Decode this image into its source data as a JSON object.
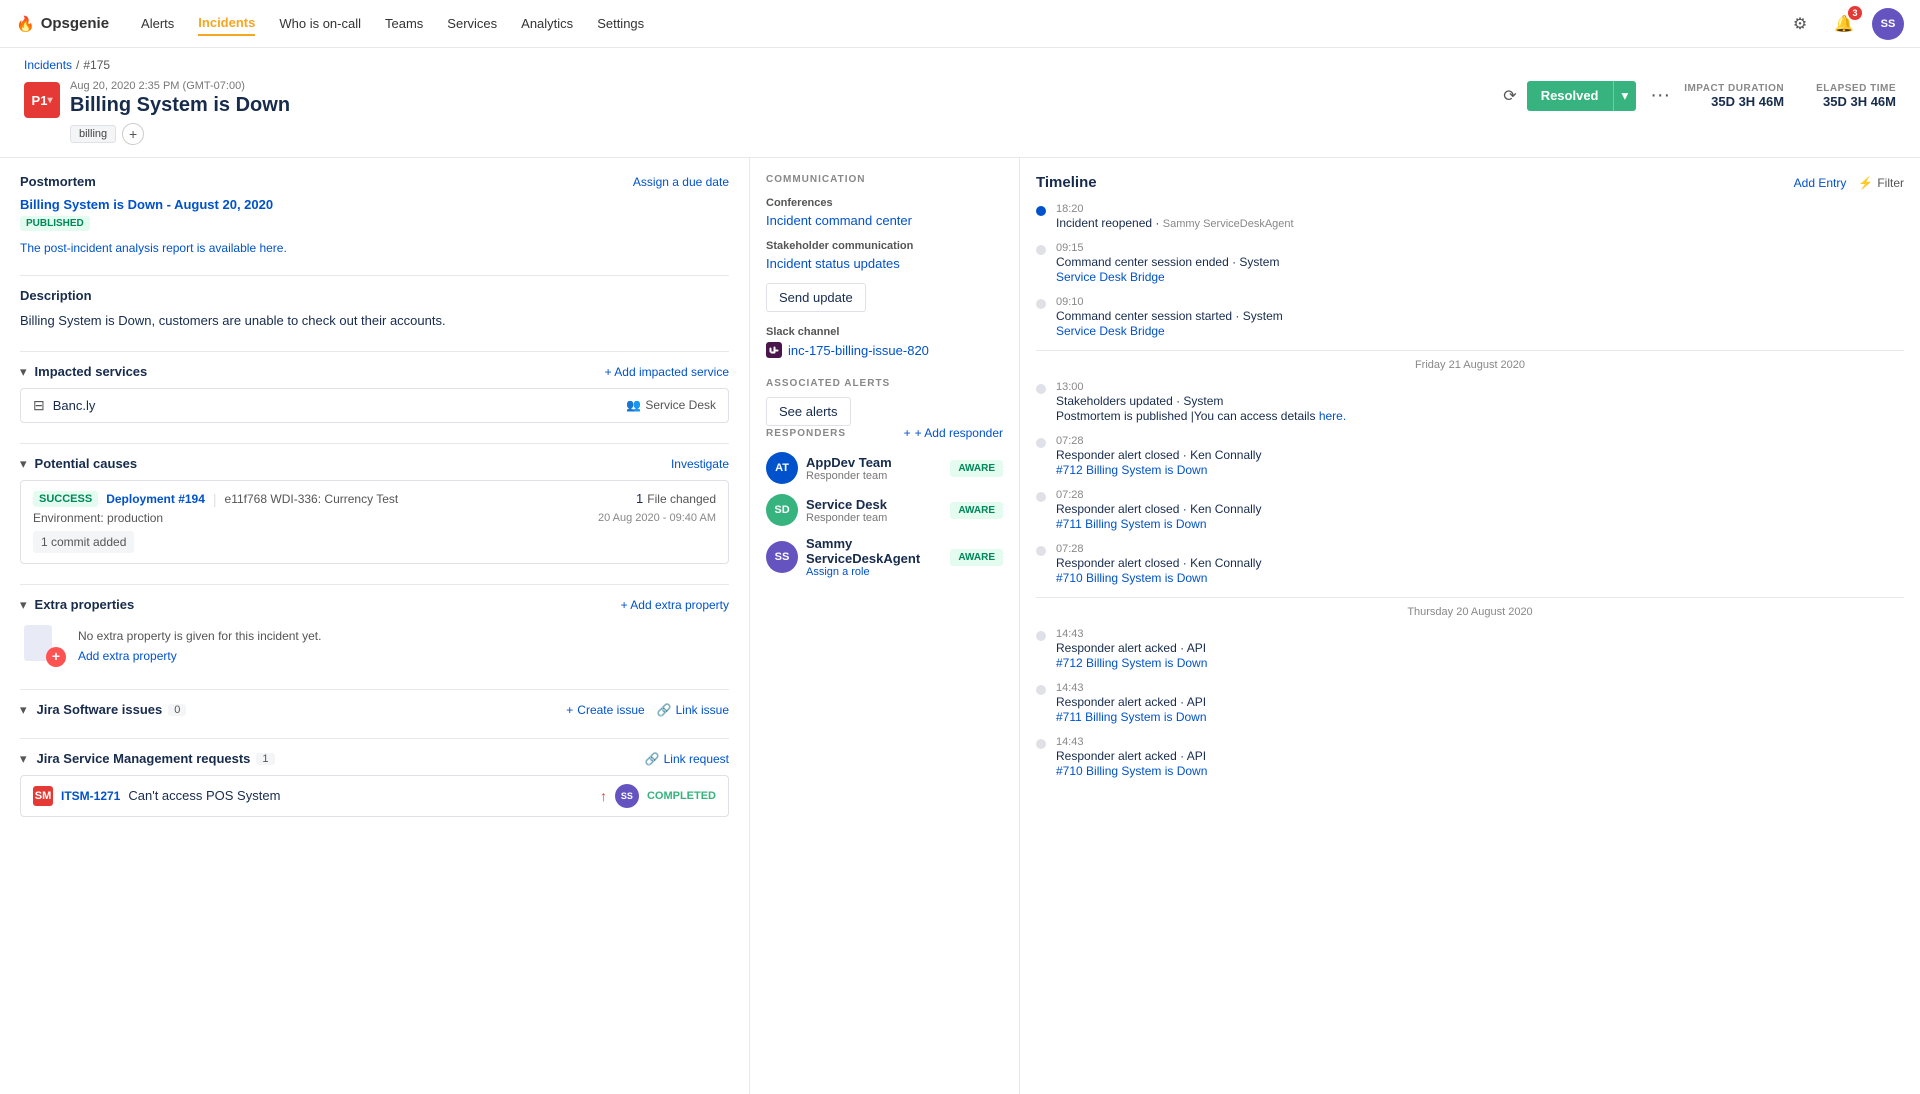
{
  "app": {
    "logo": "🔥",
    "name": "Opsgenie",
    "nav_items": [
      "Alerts",
      "Incidents",
      "Who is on-call",
      "Teams",
      "Services",
      "Analytics",
      "Settings"
    ],
    "active_nav": "Incidents",
    "notification_count": "3",
    "user_initials": "SS"
  },
  "breadcrumb": {
    "incidents_label": "Incidents",
    "separator": "/",
    "incident_id": "#175"
  },
  "incident": {
    "priority": "P1",
    "date": "Aug 20, 2020 2:35 PM (GMT-07:00)",
    "title": "Billing System is Down",
    "tags": [
      "billing"
    ],
    "add_tag_label": "+",
    "status": "Resolved",
    "impact_duration_label": "IMPACT DURATION",
    "impact_duration": "35D 3H 46M",
    "elapsed_time_label": "ELAPSED TIME",
    "elapsed_time": "35D 3H 46M"
  },
  "postmortem": {
    "section_title": "Postmortem",
    "due_date_label": "Assign a due date",
    "link_text": "Billing System is Down - August 20, 2020",
    "status": "PUBLISHED",
    "note": "The post-incident analysis report is available here."
  },
  "description": {
    "section_title": "Description",
    "text": "Billing System is Down, customers are unable to check out their accounts."
  },
  "impacted_services": {
    "section_title": "Impacted services",
    "add_label": "+ Add impacted service",
    "services": [
      {
        "name": "Banc.ly",
        "team": "Service Desk"
      }
    ]
  },
  "potential_causes": {
    "section_title": "Potential causes",
    "investigate_label": "Investigate",
    "causes": [
      {
        "status": "SUCCESS",
        "deployment": "Deployment #194",
        "commit_hash": "e11f768",
        "commit_desc": "WDI-336: Currency Test",
        "file_count": "1",
        "file_label": "File changed",
        "date": "20 Aug 2020 - 09:40 AM",
        "env": "production",
        "commit_label": "1 commit added"
      }
    ]
  },
  "extra_properties": {
    "section_title": "Extra properties",
    "add_label": "+ Add extra property",
    "empty_text": "No extra property is given for this incident yet.",
    "add_link": "Add extra property"
  },
  "jira_issues": {
    "section_title": "Jira Software issues",
    "count": "0",
    "create_label": "Create issue",
    "link_label": "Link issue"
  },
  "jira_mgmt": {
    "section_title": "Jira Service Management requests",
    "count": "1",
    "link_label": "Link request",
    "items": [
      {
        "id": "ITSM-1271",
        "title": "Can't access POS System",
        "status": "COMPLETED",
        "priority": "high"
      }
    ]
  },
  "communication": {
    "label": "COMMUNICATION",
    "conferences_label": "Conferences",
    "incident_command_center": "Incident command center",
    "stakeholder_label": "Stakeholder communication",
    "status_updates_link": "Incident status updates",
    "send_update_label": "Send update",
    "slack_label": "Slack channel",
    "slack_channel": "inc-175-billing-issue-820"
  },
  "associated_alerts": {
    "label": "ASSOCIATED ALERTS",
    "see_alerts_label": "See alerts"
  },
  "responders": {
    "label": "RESPONDERS",
    "add_label": "+ Add responder",
    "items": [
      {
        "name": "AppDev Team",
        "role": "Responder team",
        "status": "AWARE",
        "color": "#0052cc",
        "initials": "AT"
      },
      {
        "name": "Service Desk",
        "role": "Responder team",
        "status": "AWARE",
        "color": "#36b37e",
        "initials": "SD"
      },
      {
        "name": "Sammy ServiceDeskAgent",
        "role": "Assign a role",
        "status": "AWARE",
        "color": "#6554c0",
        "initials": "SS"
      }
    ]
  },
  "timeline": {
    "title": "Timeline",
    "add_entry_label": "Add Entry",
    "filter_label": "Filter",
    "entries": [
      {
        "time": "18:20",
        "desc": "Incident reopened · ",
        "actor": "Sammy ServiceDeskAgent",
        "link": "",
        "date_divider": ""
      },
      {
        "time": "09:15",
        "desc": "Command center session ended · System",
        "actor": "",
        "link": "Service Desk Bridge",
        "date_divider": ""
      },
      {
        "time": "09:10",
        "desc": "Command center session started · System",
        "actor": "",
        "link": "Service Desk Bridge",
        "date_divider": ""
      },
      {
        "time": "",
        "desc": "",
        "actor": "",
        "link": "",
        "date_divider": "Friday 21 August 2020"
      },
      {
        "time": "13:00",
        "desc": "Stakeholders updated · System",
        "actor": "",
        "link": "",
        "date_divider": ""
      },
      {
        "time": "",
        "desc": "Postmortem is published |You can access details ",
        "actor": "",
        "link": "here.",
        "date_divider": ""
      },
      {
        "time": "07:28",
        "desc": "Responder alert closed · Ken Connally",
        "actor": "",
        "link": "#712 Billing System is Down",
        "date_divider": ""
      },
      {
        "time": "07:28",
        "desc": "Responder alert closed · Ken Connally",
        "actor": "",
        "link": "#711 Billing System is Down",
        "date_divider": ""
      },
      {
        "time": "07:28",
        "desc": "Responder alert closed · Ken Connally",
        "actor": "",
        "link": "#710 Billing System is Down",
        "date_divider": ""
      },
      {
        "time": "",
        "desc": "",
        "actor": "",
        "link": "",
        "date_divider": "Thursday 20 August 2020"
      },
      {
        "time": "14:43",
        "desc": "Responder alert acked · API",
        "actor": "",
        "link": "#712 Billing System is Down",
        "date_divider": ""
      },
      {
        "time": "14:43",
        "desc": "Responder alert acked · API",
        "actor": "",
        "link": "#711 Billing System is Down",
        "date_divider": ""
      },
      {
        "time": "14:43",
        "desc": "Responder alert acked · API",
        "actor": "",
        "link": "#710 Billing System is Down",
        "date_divider": ""
      }
    ]
  }
}
